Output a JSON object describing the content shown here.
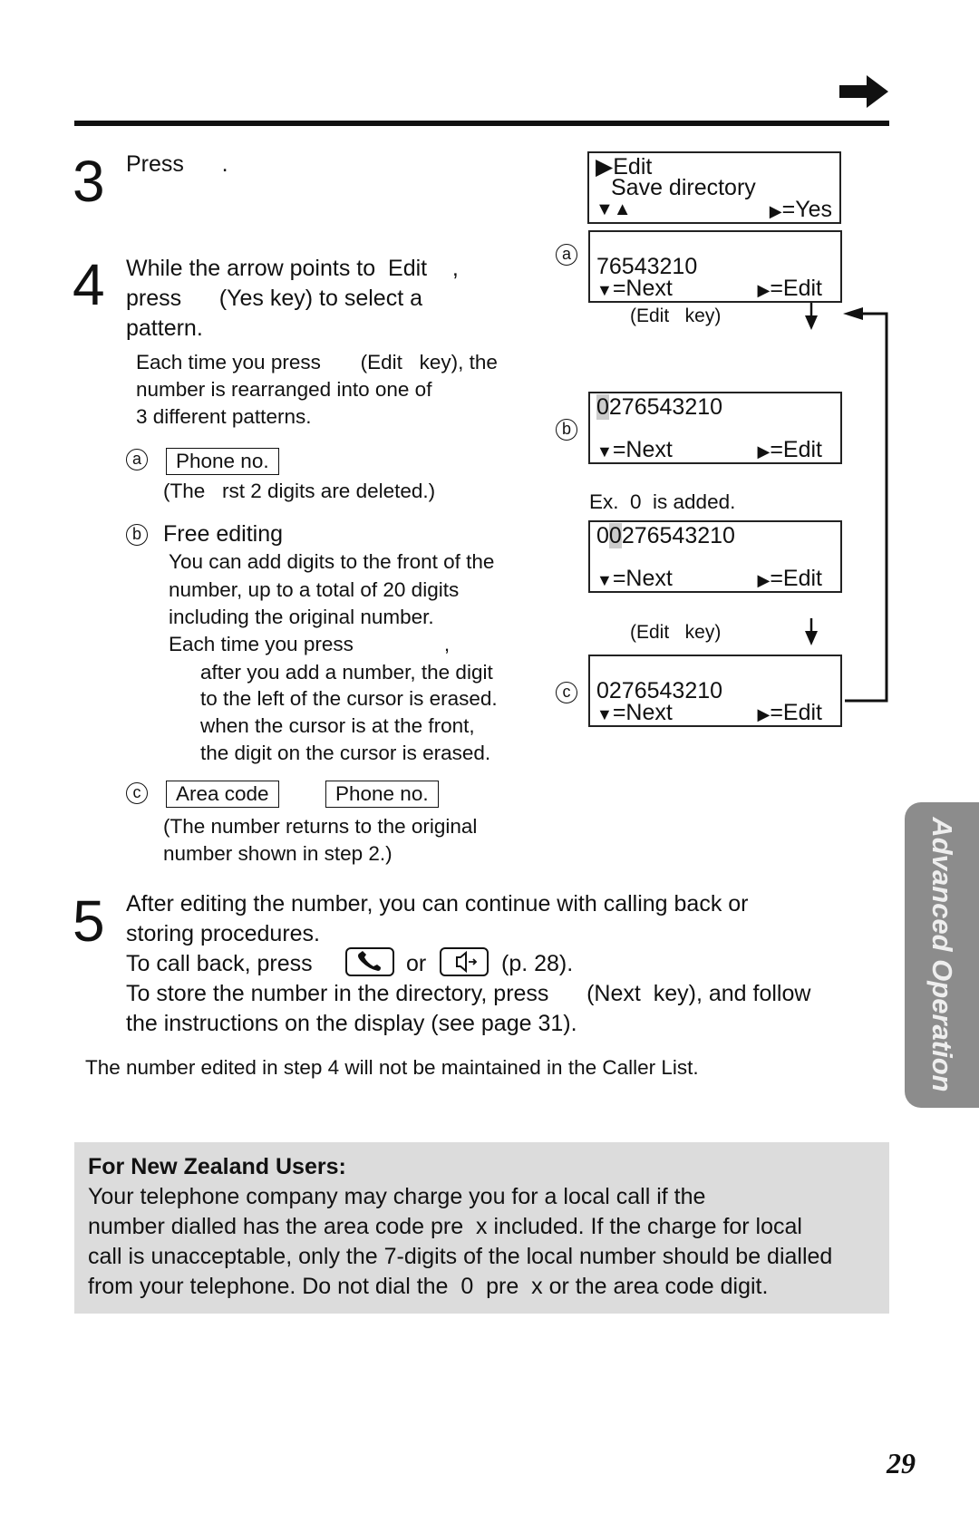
{
  "header": {
    "continue_arrow_icon": "right-arrow"
  },
  "step3": {
    "number": "3",
    "text": "Press      ."
  },
  "step4": {
    "number": "4",
    "lines": [
      "While the arrow points to  Edit    ,",
      "press      (Yes key) to select a",
      "pattern."
    ],
    "desc": [
      "Each time you press       (Edit   key), the",
      "number is rearranged into one of",
      "3 different patterns."
    ],
    "a": {
      "label": "a",
      "box": "Phone no.",
      "note": "(The   rst 2 digits are deleted.)"
    },
    "b": {
      "label": "b",
      "title": "Free editing",
      "lines": [
        "You can add digits to the front of the",
        "number, up to a total of 20 digits",
        "including the original number.",
        "Each time you press                ,"
      ],
      "sublines": [
        "after you add a number, the digit",
        "to the left of the cursor is erased.",
        "when the cursor is at the front,",
        "the digit on the cursor is erased."
      ]
    },
    "c": {
      "label": "c",
      "box1": "Area code",
      "box2": "Phone no.",
      "note": [
        "(The number returns to the original",
        "number shown in step 2.)"
      ]
    }
  },
  "displays": {
    "menu": {
      "line1": "Edit",
      "line2": "Save directory",
      "nav": "▼▲",
      "yes": "=Yes"
    },
    "a": {
      "label": "a",
      "number": "76543210",
      "next": "=Next",
      "edit": "=Edit"
    },
    "key1": "(Edit   key)",
    "b": {
      "label": "b",
      "cursor": "0",
      "number": "276543210",
      "next": "=Next",
      "edit": "=Edit"
    },
    "example": "Ex.  0  is added.",
    "b2": {
      "pre": "0",
      "cursor": "0",
      "number": "276543210",
      "next": "=Next",
      "edit": "=Edit"
    },
    "key2": "(Edit   key)",
    "c": {
      "label": "c",
      "number": "0276543210",
      "next": "=Next",
      "edit": "=Edit"
    }
  },
  "step5": {
    "number": "5",
    "line1": "After editing the number, you can continue with calling back or",
    "line2": "storing procedures.",
    "call_pre": "To call back, press",
    "call_or": "or",
    "call_post": "(p. 28).",
    "line4": "To store the number in the directory, press      (Next  key), and follow",
    "line5": "the instructions on the display (see page 31).",
    "icons": [
      "talk-phone",
      "speakerphone"
    ]
  },
  "note": "The number edited in step 4 will not be maintained in the Caller List.",
  "nz": {
    "title": "For New Zealand Users:",
    "lines": [
      "Your telephone company may charge you for a local call if the",
      "number dialled has the area code pre  x included. If the charge for local",
      "call is unacceptable, only the 7-digits of the local number should be dialled",
      "from your telephone. Do not dial the  0  pre  x or the area code digit."
    ],
    "bg": "#dcdcdc"
  },
  "sidebar_tab": {
    "label": "Advanced Operation",
    "color": "#8c8c8c"
  },
  "page_number": "29"
}
